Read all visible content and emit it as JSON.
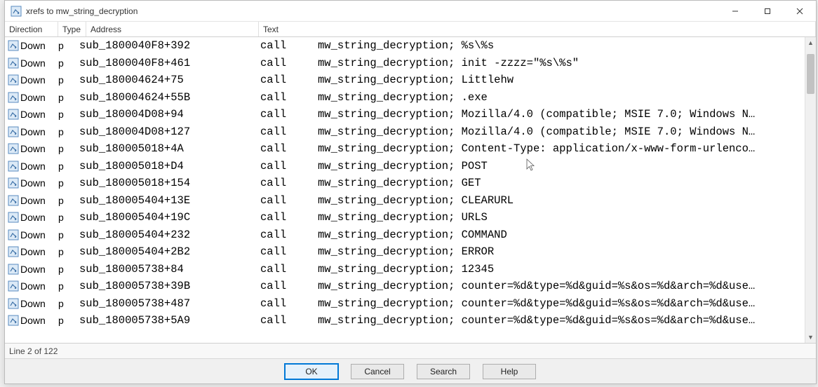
{
  "window": {
    "title": "xrefs to mw_string_decryption"
  },
  "columns": {
    "direction": "Direction",
    "type": "Type",
    "address": "Address",
    "text": "Text"
  },
  "rows": [
    {
      "direction": "Down",
      "type": "p",
      "address": "sub_1800040F8+392",
      "op": "call",
      "details": "mw_string_decryption; %s\\%s"
    },
    {
      "direction": "Down",
      "type": "p",
      "address": "sub_1800040F8+461",
      "op": "call",
      "details": "mw_string_decryption; init -zzzz=\"%s\\%s\""
    },
    {
      "direction": "Down",
      "type": "p",
      "address": "sub_180004624+75",
      "op": "call",
      "details": "mw_string_decryption; Littlehw"
    },
    {
      "direction": "Down",
      "type": "p",
      "address": "sub_180004624+55B",
      "op": "call",
      "details": "mw_string_decryption; .exe"
    },
    {
      "direction": "Down",
      "type": "p",
      "address": "sub_180004D08+94",
      "op": "call",
      "details": "mw_string_decryption; Mozilla/4.0 (compatible; MSIE 7.0; Windows N…"
    },
    {
      "direction": "Down",
      "type": "p",
      "address": "sub_180004D08+127",
      "op": "call",
      "details": "mw_string_decryption; Mozilla/4.0 (compatible; MSIE 7.0; Windows N…"
    },
    {
      "direction": "Down",
      "type": "p",
      "address": "sub_180005018+4A",
      "op": "call",
      "details": "mw_string_decryption; Content-Type: application/x-www-form-urlenco…"
    },
    {
      "direction": "Down",
      "type": "p",
      "address": "sub_180005018+D4",
      "op": "call",
      "details": "mw_string_decryption; POST"
    },
    {
      "direction": "Down",
      "type": "p",
      "address": "sub_180005018+154",
      "op": "call",
      "details": "mw_string_decryption; GET"
    },
    {
      "direction": "Down",
      "type": "p",
      "address": "sub_180005404+13E",
      "op": "call",
      "details": "mw_string_decryption; CLEARURL"
    },
    {
      "direction": "Down",
      "type": "p",
      "address": "sub_180005404+19C",
      "op": "call",
      "details": "mw_string_decryption; URLS"
    },
    {
      "direction": "Down",
      "type": "p",
      "address": "sub_180005404+232",
      "op": "call",
      "details": "mw_string_decryption; COMMAND"
    },
    {
      "direction": "Down",
      "type": "p",
      "address": "sub_180005404+2B2",
      "op": "call",
      "details": "mw_string_decryption; ERROR"
    },
    {
      "direction": "Down",
      "type": "p",
      "address": "sub_180005738+84",
      "op": "call",
      "details": "mw_string_decryption; 12345"
    },
    {
      "direction": "Down",
      "type": "p",
      "address": "sub_180005738+39B",
      "op": "call",
      "details": "mw_string_decryption; counter=%d&type=%d&guid=%s&os=%d&arch=%d&use…"
    },
    {
      "direction": "Down",
      "type": "p",
      "address": "sub_180005738+487",
      "op": "call",
      "details": "mw_string_decryption; counter=%d&type=%d&guid=%s&os=%d&arch=%d&use…"
    },
    {
      "direction": "Down",
      "type": "p",
      "address": "sub_180005738+5A9",
      "op": "call",
      "details": "mw_string_decryption; counter=%d&type=%d&guid=%s&os=%d&arch=%d&use…"
    }
  ],
  "status": "Line 2 of 122",
  "buttons": {
    "ok": "OK",
    "cancel": "Cancel",
    "search": "Search",
    "help": "Help"
  },
  "scrollbar": {
    "thumb_top_pct": 2,
    "thumb_height_pct": 14
  }
}
